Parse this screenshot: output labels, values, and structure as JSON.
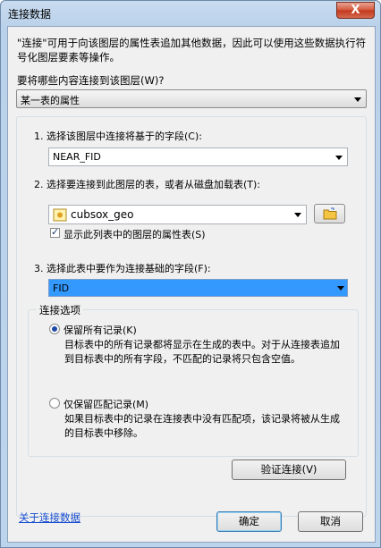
{
  "window": {
    "title": "连接数据",
    "close_glyph": "X"
  },
  "intro": "\"连接\"可用于向该图层的属性表追加其他数据，因此可以使用这些数据执行符号化图层要素等操作。",
  "question": "要将哪些内容连接到该图层(W)?",
  "join_type": {
    "value": "某一表的属性"
  },
  "step1": {
    "label": "1. 选择该图层中连接将基于的字段(C):",
    "value": "NEAR_FID"
  },
  "step2": {
    "label": "2. 选择要连接到此图层的表，或者从磁盘加载表(T):",
    "value": "cubsox_geo",
    "show_layers_label": "显示此列表中的图层的属性表(S)",
    "show_layers_checked": true
  },
  "step3": {
    "label": "3. 选择此表中要作为连接基础的字段(F):",
    "value": "FID"
  },
  "options": {
    "title": "连接选项",
    "keep_all": {
      "label": "保留所有记录(K)",
      "desc": "目标表中的所有记录都将显示在生成的表中。对于从连接表追加到目标表中的所有字段，不匹配的记录将只包含空值。",
      "selected": true
    },
    "keep_matching": {
      "label": "仅保留匹配记录(M)",
      "desc": "如果目标表中的记录在连接表中没有匹配项，该记录将被从生成的目标表中移除。",
      "selected": false
    }
  },
  "buttons": {
    "validate": "验证连接(V)",
    "ok": "确定",
    "cancel": "取消"
  },
  "help_link": "关于连接数据",
  "colors": {
    "selection": "#3399ff",
    "link": "#1a4fd1"
  }
}
